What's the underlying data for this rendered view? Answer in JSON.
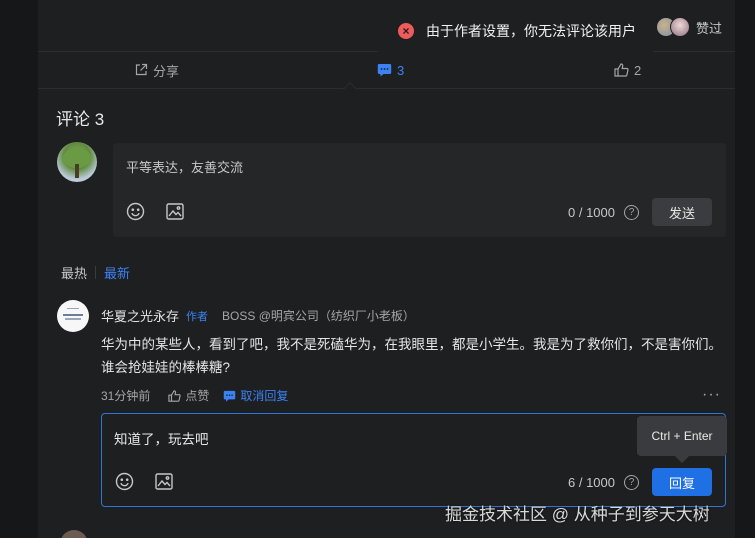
{
  "toast": {
    "icon": "close-circle-icon",
    "text": "由于作者设置，你无法评论该用户"
  },
  "liked_by": {
    "label": "赞过"
  },
  "actions": {
    "share": "分享",
    "comment_count": "3",
    "like_count": "2"
  },
  "comments": {
    "title": "评论 3",
    "composer": {
      "placeholder": "平等表达，友善交流",
      "counter": "0 / 1000",
      "send_label": "发送"
    },
    "sort": {
      "hot": "最热",
      "new": "最新"
    },
    "items": [
      {
        "name": "华夏之光永存",
        "badge": "作者",
        "title": "BOSS @明宾公司（纺织厂小老板）",
        "body": "华为中的某些人，看到了吧，我不是死磕华为，在我眼里，都是小学生。我是为了救你们，不是害你们。谁会抢娃娃的棒棒糖?",
        "time": "31分钟前",
        "like_label": "点赞",
        "reply_toggle_label": "取消回复",
        "reply": {
          "value": "知道了，玩去吧",
          "counter": "6 / 1000",
          "submit_label": "回复",
          "tooltip": "Ctrl + Enter"
        }
      }
    ]
  },
  "watermark": "掘金技术社区 @ 从种子到参天大树",
  "colors": {
    "accent": "#3b82f6",
    "error": "#ef5b5b",
    "background": "#1e1f20"
  }
}
